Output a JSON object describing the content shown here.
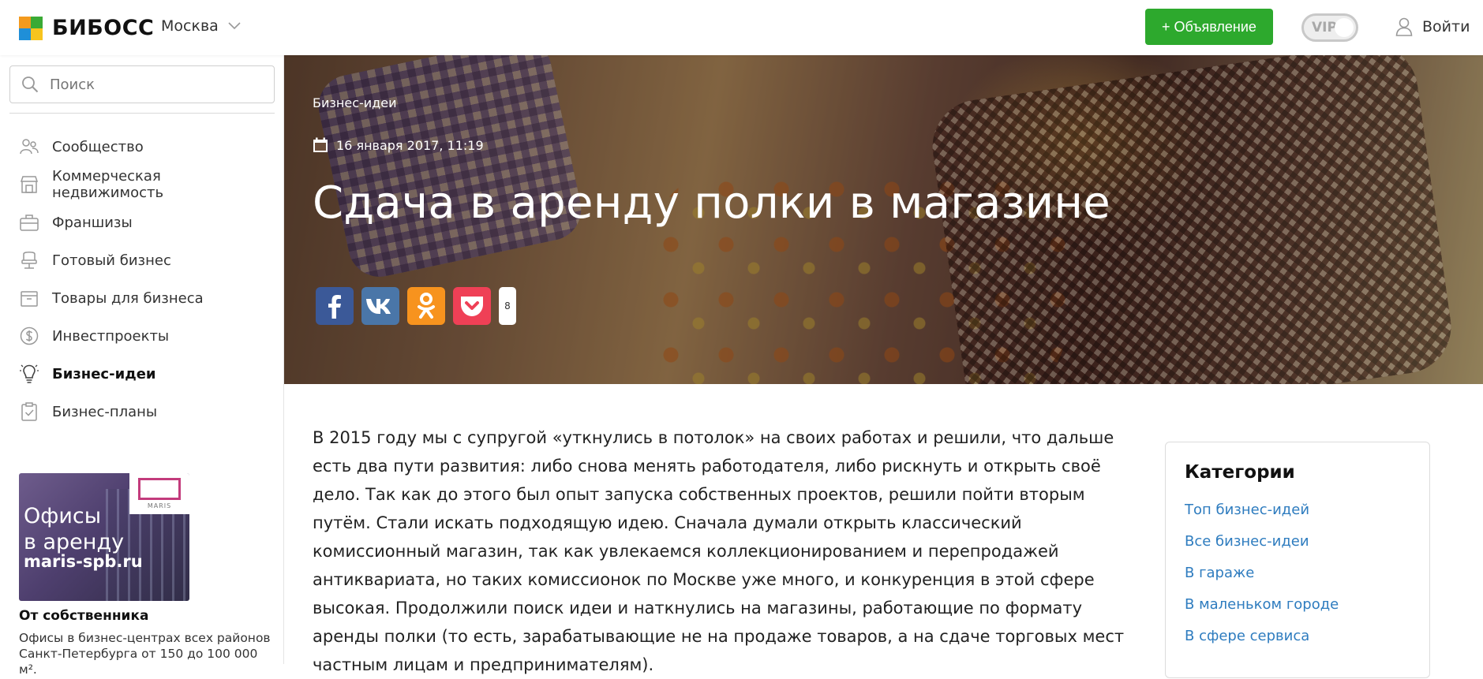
{
  "header": {
    "logo_text": "БИБОСС",
    "city": "Москва",
    "add_button": "+ Объявление",
    "vip_label": "VIP",
    "login_label": "Войти"
  },
  "colors": {
    "brand_green": "#2da92d",
    "link_blue": "#2e7cbf",
    "logo_orange": "#f39a1e",
    "logo_green": "#3aaa35",
    "logo_blue": "#1f8fd8",
    "logo_yellow": "#f7c41f"
  },
  "sidebar": {
    "search_placeholder": "Поиск",
    "items": [
      {
        "label": "Сообщество",
        "icon": "people-icon"
      },
      {
        "label": "Коммерческая недвижимость",
        "icon": "storefront-icon"
      },
      {
        "label": "Франшизы",
        "icon": "briefcase-icon"
      },
      {
        "label": "Готовый бизнес",
        "icon": "chair-icon"
      },
      {
        "label": "Товары для бизнеса",
        "icon": "box-icon"
      },
      {
        "label": "Инвестпроекты",
        "icon": "dollar-coin-icon"
      },
      {
        "label": "Бизнес-идеи",
        "icon": "lightbulb-icon",
        "active": true
      },
      {
        "label": "Бизнес-планы",
        "icon": "clipboard-check-icon"
      }
    ],
    "ad": {
      "image_text": "Офисы\nв аренду",
      "image_url_text": "maris-spb.ru",
      "brand_name": "MARIS",
      "title": "От собственника",
      "description": "Офисы в бизнес-центрах всех районов Санкт-Петербурга от 150 до 100 000 м²."
    }
  },
  "hero": {
    "category": "Бизнес-идеи",
    "date": "16 января 2017, 11:19",
    "title": "Сдача в аренду полки в магазине",
    "share": {
      "buttons": [
        {
          "network": "facebook",
          "icon": "facebook-icon",
          "color": "#3b5998"
        },
        {
          "network": "vk",
          "icon": "vk-icon",
          "color": "#4a76a8"
        },
        {
          "network": "odnoklassniki",
          "icon": "odnoklassniki-icon",
          "color": "#f7931e"
        },
        {
          "network": "pocket",
          "icon": "pocket-icon",
          "color": "#ef4056"
        }
      ],
      "count": "8"
    }
  },
  "article": {
    "paragraph": "В 2015 году мы с супругой «уткнулись в потолок» на своих работах и решили, что дальше есть два пути развития: либо снова менять работодателя, либо рискнуть и открыть своё дело. Так как до этого был опыт запуска собственных проектов, решили пойти вторым путём. Стали искать подходящую идею. Сначала думали открыть классический комиссионный магазин, так как увлекаемся коллекционированием и перепродажей антиквариата, но таких комиссионок по Москве уже много, и конкуренция в этой сфере высокая. Продолжили поиск идеи и наткнулись на магазины, работающие по формату аренды полки (то есть, зарабатывающие не на продаже товаров, а на сдаче торговых мест частным лицам и предпринимателям)."
  },
  "categories": {
    "title": "Категории",
    "items": [
      "Топ бизнес-идей",
      "Все бизнес-идеи",
      "В гараже",
      "В маленьком городе",
      "В сфере сервиса"
    ]
  }
}
